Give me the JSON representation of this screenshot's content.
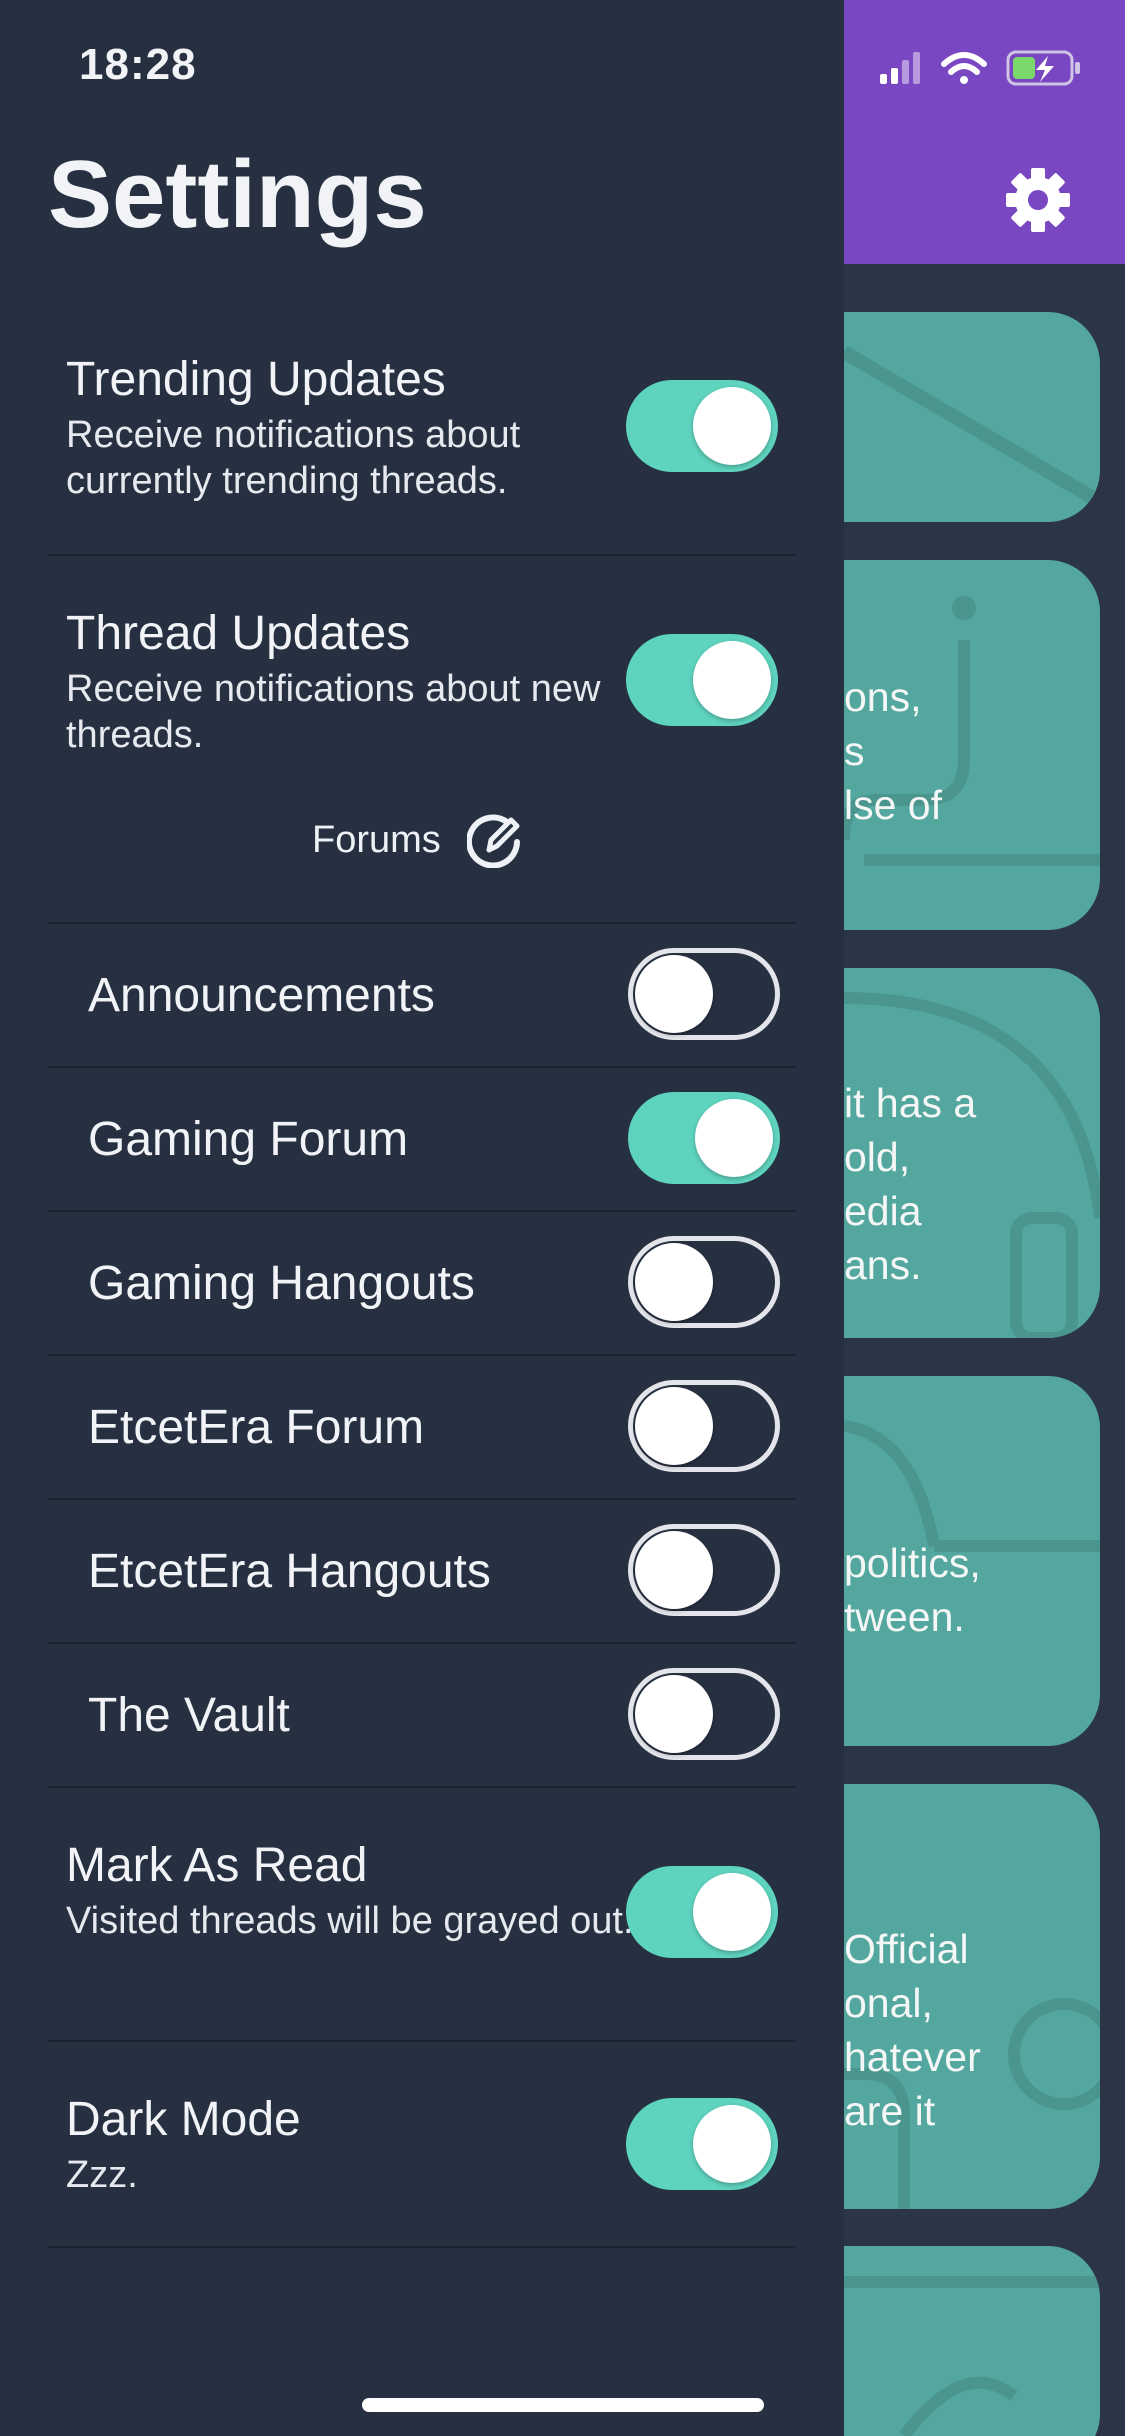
{
  "status_bar": {
    "time": "18:28"
  },
  "settings": {
    "title": "Settings",
    "trending": {
      "title": "Trending Updates",
      "desc": "Receive notifications about currently trending threads.",
      "on": true
    },
    "thread": {
      "title": "Thread Updates",
      "desc": "Receive notifications about new threads.",
      "on": true
    },
    "forums_label": "Forums",
    "forums": [
      {
        "label": "Announcements",
        "on": false
      },
      {
        "label": "Gaming Forum",
        "on": true
      },
      {
        "label": "Gaming Hangouts",
        "on": false
      },
      {
        "label": "EtcetEra Forum",
        "on": false
      },
      {
        "label": "EtcetEra Hangouts",
        "on": false
      },
      {
        "label": "The Vault",
        "on": false
      }
    ],
    "mark_read": {
      "title": "Mark As Read",
      "desc": "Visited threads will be grayed out.",
      "on": true
    },
    "dark_mode": {
      "title": "Dark Mode",
      "desc": "Zzz.",
      "on": true
    }
  },
  "background_cards": [
    {
      "lines": ""
    },
    {
      "lines": "ons,\ns\nlse of"
    },
    {
      "lines": "it has a\nold,\nedia\nans."
    },
    {
      "lines": "politics,\ntween."
    },
    {
      "lines": "Official\nonal,\nhatever\nare it"
    },
    {
      "lines": ""
    }
  ],
  "colors": {
    "accent_toggle": "#5ed3bd",
    "drawer_bg": "#263041",
    "header_purple": "#7a47c2",
    "card_teal": "#54a79f"
  },
  "icons": {
    "settings": "gear-icon",
    "edit": "edit-icon",
    "wifi": "wifi-icon",
    "battery": "battery-charging-icon",
    "signal": "signal-icon"
  }
}
